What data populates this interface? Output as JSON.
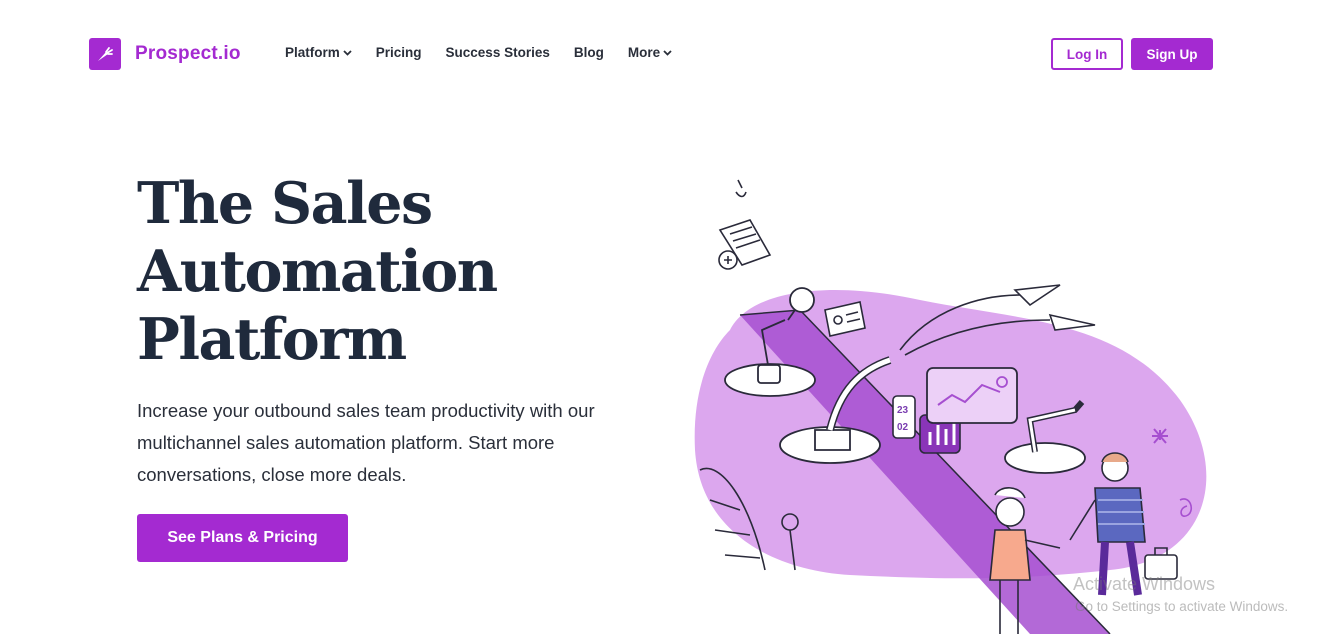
{
  "brand": {
    "name": "Prospect.io",
    "color": "#a42ad1",
    "logo_icon": "carrot-icon"
  },
  "nav": {
    "items": [
      {
        "label": "Platform",
        "has_dropdown": true
      },
      {
        "label": "Pricing",
        "has_dropdown": false
      },
      {
        "label": "Success Stories",
        "has_dropdown": false
      },
      {
        "label": "Blog",
        "has_dropdown": false
      },
      {
        "label": "More",
        "has_dropdown": true
      }
    ]
  },
  "auth": {
    "login_label": "Log In",
    "signup_label": "Sign Up"
  },
  "hero": {
    "title_lines": [
      "The Sales",
      "Automation",
      "Platform"
    ],
    "subtitle": "Increase your outbound sales team productivity with our multichannel sales automation platform. Start more conversations, close more deals.",
    "cta_label": "See Plans & Pricing"
  },
  "illustration": {
    "calendar_day": "23",
    "calendar_month": "02"
  },
  "watermark": {
    "title": "Activate Windows",
    "subtitle": "Go to Settings to activate Windows."
  }
}
